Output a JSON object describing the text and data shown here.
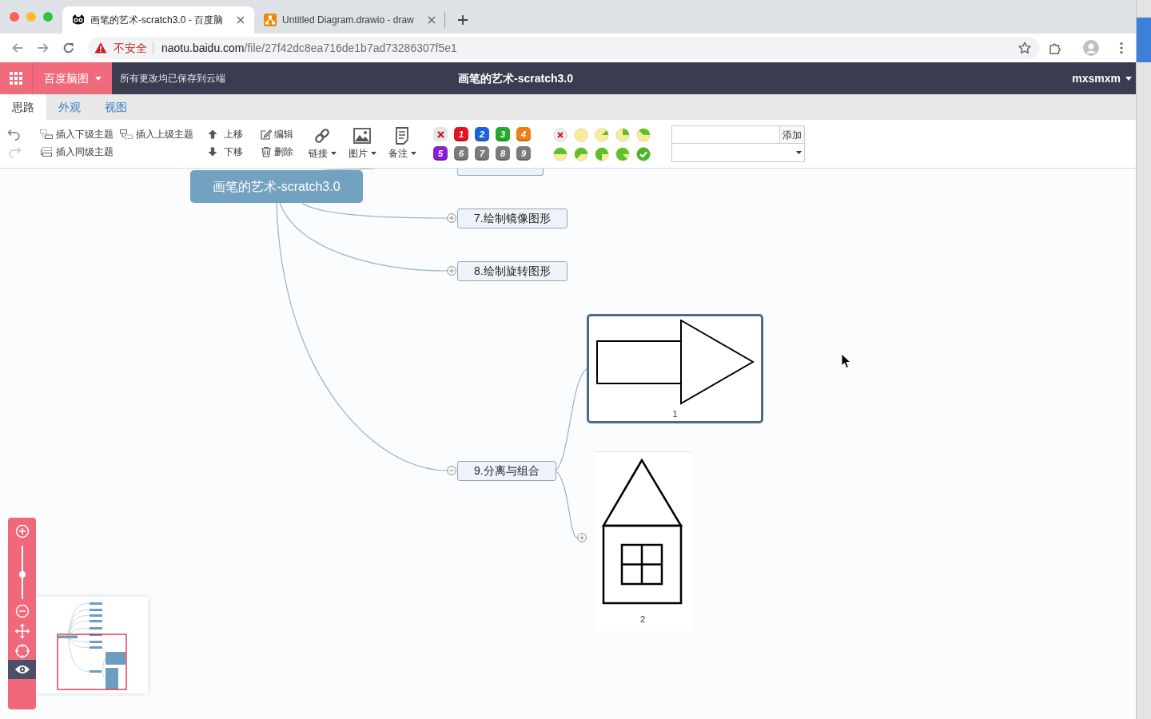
{
  "browser": {
    "tabs": [
      {
        "title": "画笔的艺术-scratch3.0 - 百度脑",
        "selected": true
      },
      {
        "title": "Untitled Diagram.drawio - draw",
        "selected": false
      }
    ],
    "security": "不安全",
    "url": {
      "host": "naotu.baidu.com",
      "path": "/file/27f42dc8ea716de1b7ad73286307f5e1"
    }
  },
  "app_bar": {
    "brand": "百度脑图",
    "save_status": "所有更改均已保存到云端",
    "title": "画笔的艺术-scratch3.0",
    "user": "mxsmxm"
  },
  "ribbon_tabs": [
    {
      "label": "思路",
      "selected": true
    },
    {
      "label": "外观",
      "selected": false
    },
    {
      "label": "视图",
      "selected": false
    }
  ],
  "toolbar": {
    "history": [
      {
        "kind": "undo",
        "disabled": false
      },
      {
        "kind": "redo",
        "disabled": true
      }
    ],
    "insert": [
      {
        "kind": "child",
        "label": "插入下级主题"
      },
      {
        "kind": "parent",
        "label": "插入上级主题"
      },
      {
        "kind": "sibling",
        "label": "插入同级主题"
      }
    ],
    "move": [
      {
        "kind": "up",
        "label": "上移"
      },
      {
        "kind": "down",
        "label": "下移"
      }
    ],
    "edit": [
      {
        "kind": "edit",
        "label": "编辑"
      },
      {
        "kind": "delete",
        "label": "删除"
      }
    ],
    "media": [
      {
        "kind": "link",
        "label": "链接"
      },
      {
        "kind": "image",
        "label": "图片"
      },
      {
        "kind": "note",
        "label": "备注"
      }
    ],
    "priority": [
      {
        "kind": "clear"
      },
      {
        "kind": "number",
        "label": "1",
        "color": "#e3141c"
      },
      {
        "kind": "number",
        "label": "2",
        "color": "#1e63de"
      },
      {
        "kind": "number",
        "label": "3",
        "color": "#25a82b"
      },
      {
        "kind": "number",
        "label": "4",
        "color": "#ee7f17"
      },
      {
        "kind": "number",
        "label": "5",
        "color": "#8a1ed6"
      },
      {
        "kind": "number",
        "label": "6",
        "color": "#7b7b7b"
      },
      {
        "kind": "number",
        "label": "7",
        "color": "#7b7b7b"
      },
      {
        "kind": "number",
        "label": "8",
        "color": "#7b7b7b"
      },
      {
        "kind": "number",
        "label": "9",
        "color": "#7b7b7b"
      }
    ],
    "progress": [
      {
        "kind": "clear"
      },
      {
        "kind": "empty"
      },
      {
        "kind": "one-eighth"
      },
      {
        "kind": "quarter"
      },
      {
        "kind": "three-eighths"
      },
      {
        "kind": "half"
      },
      {
        "kind": "five-eighths"
      },
      {
        "kind": "three-quarters"
      },
      {
        "kind": "seven-eighths"
      },
      {
        "kind": "done"
      }
    ],
    "resource": {
      "button": "添加"
    }
  },
  "mind_map": {
    "root": {
      "label": "画笔的艺术-scratch3.0"
    },
    "topics": [
      {
        "clipped": true
      },
      {
        "clipped": false,
        "label": "7.绘制镜像图形",
        "expanded": false
      },
      {
        "clipped": false,
        "label": "8.绘制旋转图形",
        "expanded": false
      },
      {
        "clipped": false,
        "label": "9.分离与组合",
        "expanded": true,
        "children": [
          {
            "caption": "1",
            "selected": true
          },
          {
            "caption": "2",
            "selected": false,
            "expanded": false
          }
        ]
      }
    ]
  },
  "zoom_panel": {
    "level": 0.46,
    "minimap_on": true
  }
}
